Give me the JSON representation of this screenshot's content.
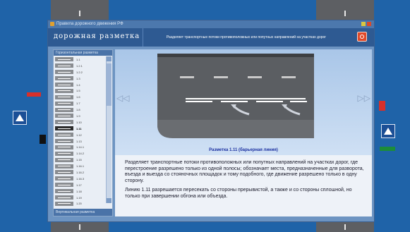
{
  "window": {
    "title": "Правила дорожного движения РФ",
    "header_title": "дорожная разметка",
    "header_subtitle": "Разделяет транспортные потоки противоположных или попутных направлений на участках дорог",
    "list_header": "Горизонтальная разметка",
    "list_footer": "Вертикальная разметка"
  },
  "list_items": [
    {
      "label": "1.1",
      "selected": false
    },
    {
      "label": "1.2.1",
      "selected": false
    },
    {
      "label": "1.2.2",
      "selected": false
    },
    {
      "label": "1.3",
      "selected": false
    },
    {
      "label": "1.4",
      "selected": false
    },
    {
      "label": "1.5",
      "selected": false
    },
    {
      "label": "1.6",
      "selected": false
    },
    {
      "label": "1.7",
      "selected": false
    },
    {
      "label": "1.8",
      "selected": false
    },
    {
      "label": "1.9",
      "selected": false
    },
    {
      "label": "1.10",
      "selected": false
    },
    {
      "label": "1.11",
      "selected": true
    },
    {
      "label": "1.12",
      "selected": false
    },
    {
      "label": "1.13",
      "selected": false
    },
    {
      "label": "1.14.1",
      "selected": false
    },
    {
      "label": "1.14.2",
      "selected": false
    },
    {
      "label": "1.15",
      "selected": false
    },
    {
      "label": "1.16.1",
      "selected": false
    },
    {
      "label": "1.16.2",
      "selected": false
    },
    {
      "label": "1.16.3",
      "selected": false
    },
    {
      "label": "1.17",
      "selected": false
    },
    {
      "label": "1.18",
      "selected": false
    },
    {
      "label": "1.19",
      "selected": false
    },
    {
      "label": "1.20",
      "selected": false
    }
  ],
  "content": {
    "caption": "Разметка 1.11 (барьерная линия)",
    "paragraph1": "Разделяет транспортные потоки противоположных или попутных направлений на участках дорог, где перестроение разрешено только из одной полосы; обозначает места, предназначенные для разворота, въезда и выезда со стояночных площадок и тому подобного, где движение разрешено только в одну сторону.",
    "paragraph2": "Линию 1.11 разрешается пересекать со стороны прерывистой, а также и со стороны сплошной, но только при завершении обгона или объезда.",
    "nav_prev": "◁◁",
    "nav_next": "▷▷"
  },
  "colors": {
    "background": "#1f63a8",
    "window": "#6d94c2",
    "header": "#2e5a92",
    "caption": "#1a2fa0",
    "close_button": "#e04a2a"
  },
  "icons": [
    "app-icon",
    "minimize-icon",
    "close-window-icon",
    "power-icon",
    "nav-prev-icon",
    "nav-next-icon",
    "pedestrian-sign-icon",
    "traffic-light-icon"
  ]
}
